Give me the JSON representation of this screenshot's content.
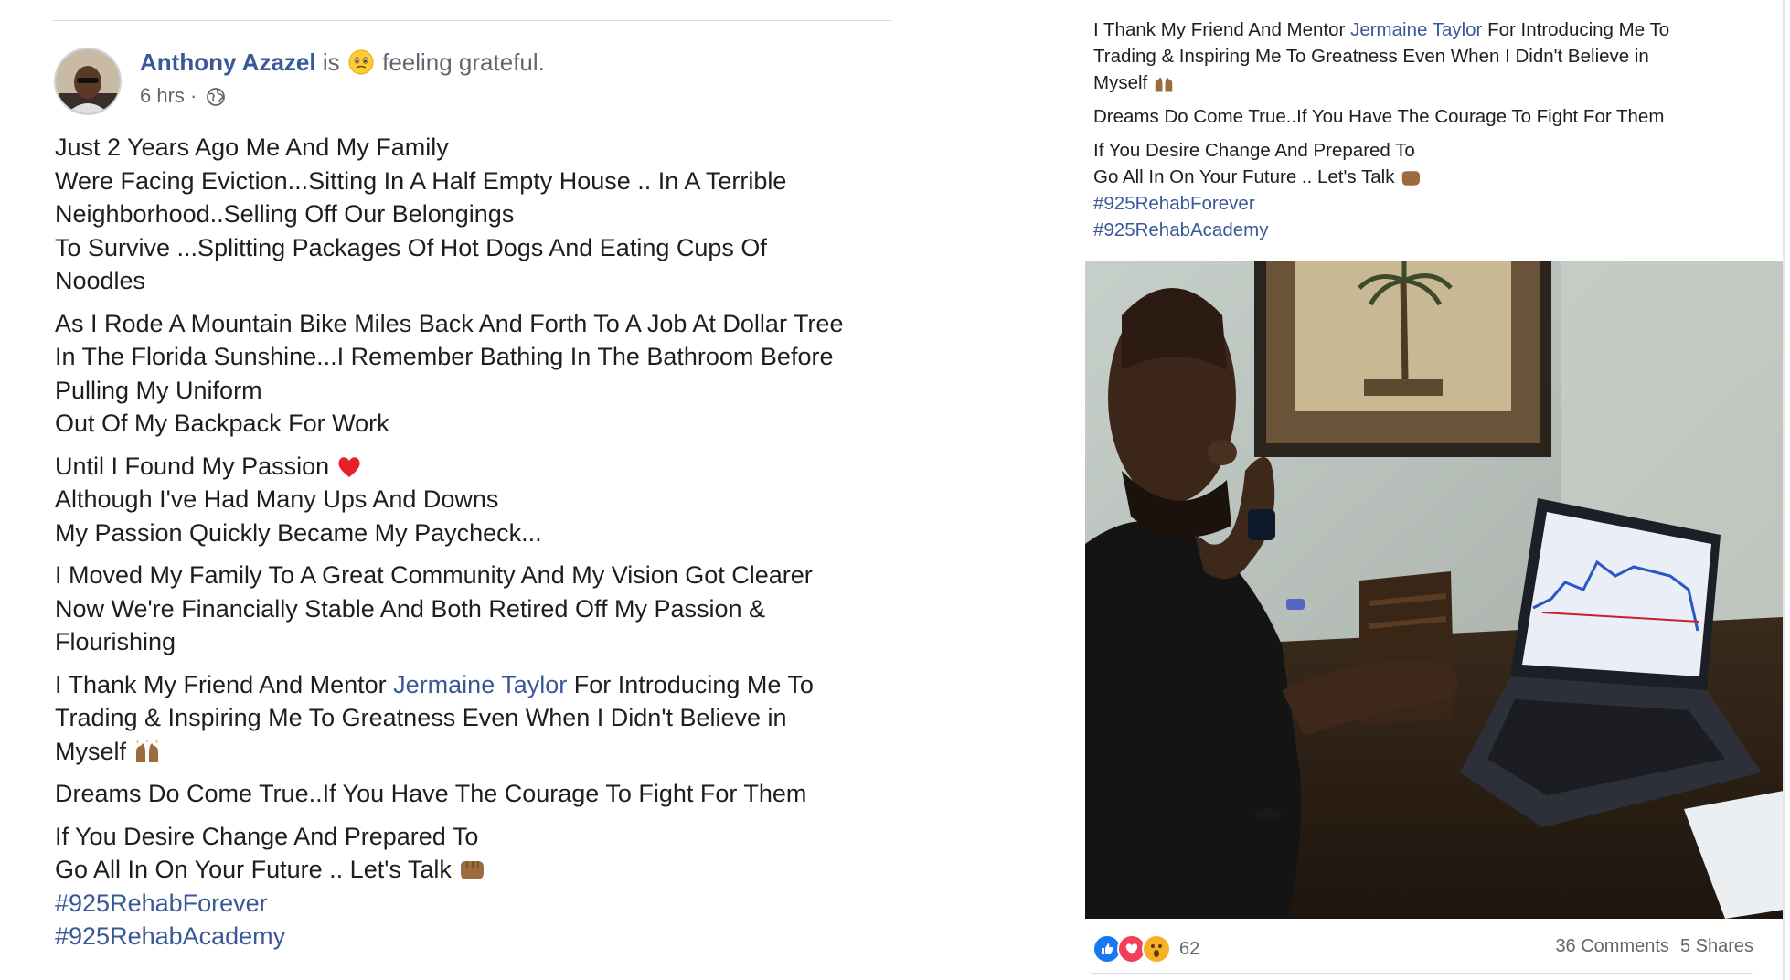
{
  "post": {
    "author": "Anthony Azazel",
    "is_text": "is",
    "feeling_text": "feeling grateful.",
    "time": "6 hrs ·",
    "body": [
      [
        "Just 2 Years Ago Me And My Family",
        "Were Facing Eviction...Sitting In A Half Empty House .. In A Terrible",
        "Neighborhood..Selling Off Our Belongings",
        "To Survive ...Splitting Packages Of Hot Dogs And Eating Cups Of",
        "Noodles"
      ],
      [
        "As I Rode A Mountain Bike Miles Back And Forth To A Job At Dollar Tree",
        "In The Florida Sunshine...I Remember Bathing In The Bathroom Before",
        "Pulling My Uniform",
        "Out Of My Backpack For Work"
      ],
      [
        "Until I Found My Passion",
        "Although I've Had Many Ups And Downs",
        "My Passion Quickly Became My Paycheck..."
      ],
      [
        "I Moved My Family To A Great Community And My Vision Got Clearer",
        "Now We're Financially Stable And Both Retired Off My Passion &",
        "Flourishing"
      ]
    ],
    "thanks": {
      "before": "I Thank My Friend And Mentor ",
      "mentor": "Jermaine Taylor",
      "after": " For Introducing Me To",
      "line2": "Trading & Inspiring Me To Greatness Even When I Didn't Believe in",
      "line3": "Myself"
    },
    "dreams": "Dreams Do Come True..If You Have The Courage To Fight For Them",
    "desire1": "If You Desire Change And Prepared To",
    "desire2": "Go All In On Your Future .. Let's Talk",
    "hashtag1": "#925RehabForever",
    "hashtag2": "#925RehabAcademy"
  },
  "footer": {
    "reaction_count": "62",
    "comments": "36 Comments",
    "shares": "5 Shares"
  },
  "colors": {
    "link": "#385898",
    "like": "#1877f2",
    "love": "#f33e58",
    "wow": "#f7b125"
  },
  "icons": [
    "globe-icon",
    "heart-emoji-icon",
    "raised-hands-emoji-icon",
    "fist-bump-emoji-icon",
    "like-reaction-icon",
    "love-reaction-icon",
    "wow-reaction-icon"
  ]
}
